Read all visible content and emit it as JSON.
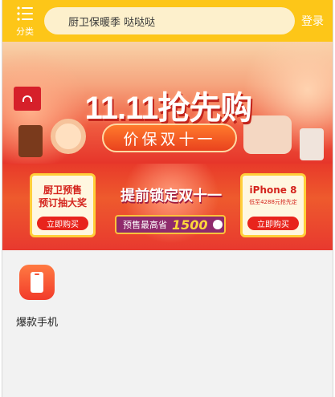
{
  "header": {
    "menu_label": "分类",
    "search_text": "厨卫保暖季 哒哒哒",
    "login_label": "登录",
    "bg_color": "#fdc618"
  },
  "banner": {
    "headline": "11.11抢先购",
    "subline": "价保双十一"
  },
  "promo": {
    "left_title_1": "厨卫预售",
    "left_title_2": "预订抽大奖",
    "left_button": "立即购买",
    "center_title": "提前锁定双十一",
    "center_label": "预售最高省",
    "center_amount": "1500",
    "right_title": "iPhone 8",
    "right_sub": "低至4288元抢先定",
    "right_button": "立即购买"
  },
  "categories": [
    {
      "label": "爆款手机",
      "icon": "phone-icon"
    }
  ]
}
